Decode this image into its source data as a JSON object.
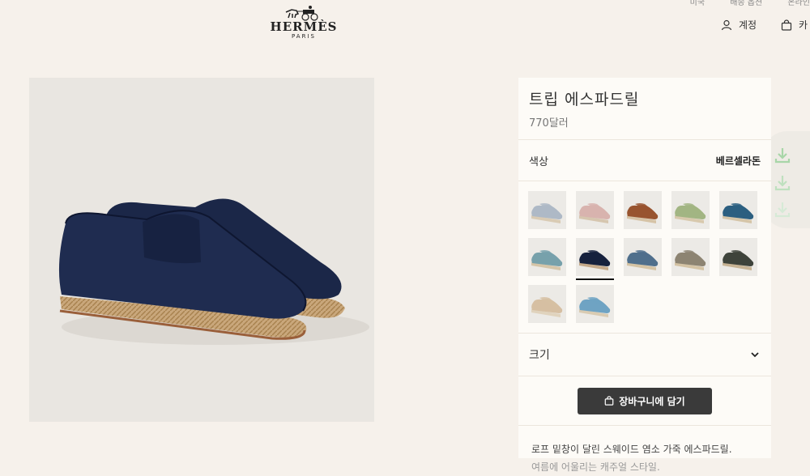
{
  "topnav": {
    "links": [
      "미국",
      "배송 옵션",
      "온라인"
    ]
  },
  "brand": {
    "name": "HERMÈS",
    "city": "PARIS"
  },
  "header": {
    "account_label": "계정",
    "cart_label": "카"
  },
  "product": {
    "title": "트립 에스파드릴",
    "price": "770달러",
    "color_label": "색상",
    "color_value": "베르셀라돈",
    "size_label": "크기",
    "add_to_cart": "장바구니에 담기",
    "description_line1": "로프 밑창이 달린 스웨이드 염소 가죽 에스파드릴.",
    "description_line2": "여름에 어울리는 캐주얼 스타일."
  },
  "swatches": [
    {
      "upper": "#aeb9c6",
      "sole": "#d9cbb4"
    },
    {
      "upper": "#d8b3ae",
      "sole": "#d6c6af"
    },
    {
      "upper": "#98542f",
      "sole": "#d6c3a6"
    },
    {
      "upper": "#a2b583",
      "sole": "#d8c9ad"
    },
    {
      "upper": "#2c5f80",
      "sole": "#d5c5a8"
    },
    {
      "upper": "#77a1ab",
      "sole": "#d5c5a8"
    },
    {
      "upper": "#16213d",
      "sole": "#c4a98a"
    },
    {
      "upper": "#4f6f8c",
      "sole": "#d4c3a4"
    },
    {
      "upper": "#8d8472",
      "sole": "#d4c3a4"
    },
    {
      "upper": "#3e433b",
      "sole": "#c7b394"
    },
    {
      "upper": "#d6bfa2",
      "sole": "#e0d3bd"
    },
    {
      "upper": "#6fa3c3",
      "sole": "#d9cbb2"
    }
  ],
  "selected_swatch": 6,
  "colors": {
    "background": "#f6f1eb",
    "panel": "#fdfbf7",
    "button": "#3a3a3a",
    "shoe": "#1b2748",
    "download_icon": "#a8d6a8"
  }
}
